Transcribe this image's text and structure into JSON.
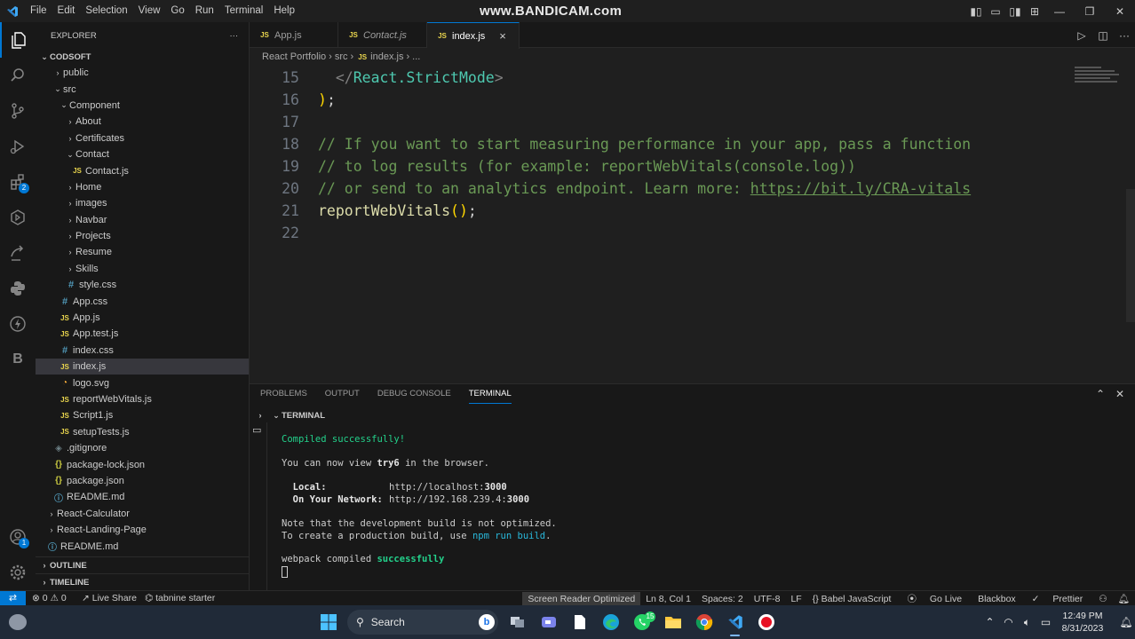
{
  "watermark": "www.BANDICAM.com",
  "menu": [
    "File",
    "Edit",
    "Selection",
    "View",
    "Go",
    "Run",
    "Terminal",
    "Help"
  ],
  "explorer": {
    "header": "EXPLORER",
    "more": "···",
    "root": "CODSOFT",
    "items": [
      {
        "label": "public",
        "kind": "folder",
        "open": false,
        "indent": 1
      },
      {
        "label": "src",
        "kind": "folder",
        "open": true,
        "indent": 1
      },
      {
        "label": "Component",
        "kind": "folder",
        "open": true,
        "indent": 2
      },
      {
        "label": "About",
        "kind": "folder",
        "open": false,
        "indent": 3
      },
      {
        "label": "Certificates",
        "kind": "folder",
        "open": false,
        "indent": 3
      },
      {
        "label": "Contact",
        "kind": "folder",
        "open": true,
        "indent": 3
      },
      {
        "label": "Contact.js",
        "kind": "js",
        "indent": 4
      },
      {
        "label": "Home",
        "kind": "folder",
        "open": false,
        "indent": 3
      },
      {
        "label": "images",
        "kind": "folder",
        "open": false,
        "indent": 3
      },
      {
        "label": "Navbar",
        "kind": "folder",
        "open": false,
        "indent": 3
      },
      {
        "label": "Projects",
        "kind": "folder",
        "open": false,
        "indent": 3
      },
      {
        "label": "Resume",
        "kind": "folder",
        "open": false,
        "indent": 3
      },
      {
        "label": "Skills",
        "kind": "folder",
        "open": false,
        "indent": 3
      },
      {
        "label": "style.css",
        "kind": "css",
        "indent": 3
      },
      {
        "label": "App.css",
        "kind": "css",
        "indent": 2
      },
      {
        "label": "App.js",
        "kind": "js",
        "indent": 2
      },
      {
        "label": "App.test.js",
        "kind": "js",
        "indent": 2
      },
      {
        "label": "index.css",
        "kind": "css",
        "indent": 2
      },
      {
        "label": "index.js",
        "kind": "js",
        "indent": 2,
        "selected": true
      },
      {
        "label": "logo.svg",
        "kind": "svg",
        "indent": 2
      },
      {
        "label": "reportWebVitals.js",
        "kind": "js",
        "indent": 2
      },
      {
        "label": "Script1.js",
        "kind": "js",
        "indent": 2
      },
      {
        "label": "setupTests.js",
        "kind": "js",
        "indent": 2
      },
      {
        "label": ".gitignore",
        "kind": "git",
        "indent": 1
      },
      {
        "label": "package-lock.json",
        "kind": "json",
        "indent": 1
      },
      {
        "label": "package.json",
        "kind": "json",
        "indent": 1
      },
      {
        "label": "README.md",
        "kind": "md",
        "indent": 1
      },
      {
        "label": "React-Calculator",
        "kind": "folder",
        "open": false,
        "indent": 0
      },
      {
        "label": "React-Landing-Page",
        "kind": "folder",
        "open": false,
        "indent": 0
      },
      {
        "label": "README.md",
        "kind": "md",
        "indent": 0
      }
    ],
    "outline": "OUTLINE",
    "timeline": "TIMELINE"
  },
  "activity": {
    "extensions_badge": "2",
    "accounts_badge": "1",
    "b_label": "B"
  },
  "tabs": [
    {
      "label": "App.js",
      "italic": false,
      "active": false
    },
    {
      "label": "Contact.js",
      "italic": true,
      "active": false
    },
    {
      "label": "index.js",
      "italic": false,
      "active": true
    }
  ],
  "tab_close": "×",
  "breadcrumb": [
    "React Portfolio",
    "src",
    "index.js",
    "..."
  ],
  "editor": {
    "lines": [
      {
        "n": "15",
        "parts": [
          {
            "t": "  ",
            "c": "tk-plain"
          },
          {
            "t": "</",
            "c": "tk-punc"
          },
          {
            "t": "React.StrictMode",
            "c": "tk-tag"
          },
          {
            "t": ">",
            "c": "tk-punc"
          }
        ]
      },
      {
        "n": "16",
        "parts": [
          {
            "t": ")",
            "c": "tk-brace"
          },
          {
            "t": ";",
            "c": "tk-plain"
          }
        ]
      },
      {
        "n": "17",
        "parts": []
      },
      {
        "n": "18",
        "parts": [
          {
            "t": "// If you want to start measuring performance in your app, pass a function",
            "c": "tk-cm"
          }
        ]
      },
      {
        "n": "19",
        "parts": [
          {
            "t": "// to log results (for example: reportWebVitals(console.log))",
            "c": "tk-cm"
          }
        ]
      },
      {
        "n": "20",
        "parts": [
          {
            "t": "// or send to an analytics endpoint. Learn more: ",
            "c": "tk-cm"
          },
          {
            "t": "https://bit.ly/CRA-vitals",
            "c": "tk-link"
          }
        ]
      },
      {
        "n": "21",
        "parts": [
          {
            "t": "reportWebVitals",
            "c": "tk-fn"
          },
          {
            "t": "()",
            "c": "tk-brace"
          },
          {
            "t": ";",
            "c": "tk-plain"
          }
        ]
      },
      {
        "n": "22",
        "parts": []
      }
    ]
  },
  "panel": {
    "tabs": [
      "PROBLEMS",
      "OUTPUT",
      "DEBUG CONSOLE",
      "TERMINAL"
    ],
    "active_tab": "TERMINAL",
    "terminal_title": "TERMINAL",
    "output": {
      "compiled": "Compiled successfully!",
      "view_pre": "You can now view ",
      "app_name": "try6",
      "view_post": " in the browser.",
      "local_label": "  Local:",
      "local_url_pre": "http://localhost:",
      "local_port": "3000",
      "network_label": "  On Your Network:",
      "network_url_pre": "http://192.168.239.4:",
      "network_port": "3000",
      "note1": "Note that the development build is not optimized.",
      "note2_pre": "To create a production build, use ",
      "note2_cmd": "npm run build",
      "note2_post": ".",
      "webpack_pre": "webpack compiled ",
      "webpack_status": "successfully"
    }
  },
  "statusbar": {
    "errors": "0",
    "warnings": "0",
    "live_share": "Live Share",
    "tabnine": "tabnine starter",
    "right": [
      "Screen Reader Optimized",
      "Ln 8, Col 1",
      "Spaces: 2",
      "UTF-8",
      "LF",
      "{} Babel JavaScript",
      "Go Live",
      "Blackbox",
      "Prettier"
    ]
  },
  "taskbar": {
    "search": "Search",
    "whatsapp_badge": "15",
    "time": "12:49 PM",
    "date": "8/31/2023"
  },
  "colors": {
    "accent": "#0078d4",
    "bg": "#1f1f1f",
    "sidebar": "#181818",
    "comment": "#6a9955"
  }
}
